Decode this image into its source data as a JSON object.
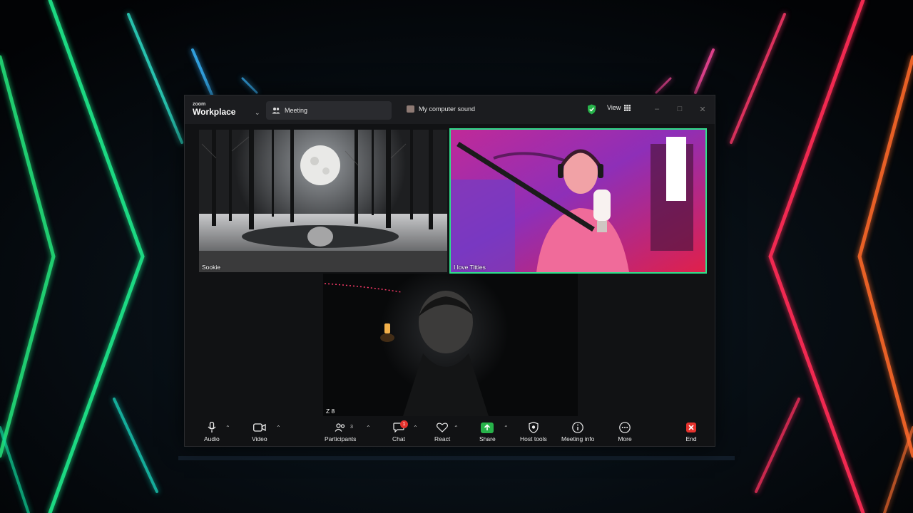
{
  "window": {
    "brand_small": "zoom",
    "brand_name": "Workplace",
    "tab_meeting_label": "Meeting",
    "tab_sound_label": "My computer sound",
    "view_label": "View"
  },
  "participants": [
    {
      "name": "Sookie"
    },
    {
      "name": "I love Titties"
    },
    {
      "name": "Z 8"
    }
  ],
  "toolbar": {
    "audio_label": "Audio",
    "video_label": "Video",
    "participants_label": "Participants",
    "participants_count": "3",
    "chat_label": "Chat",
    "chat_badge": "1",
    "react_label": "React",
    "share_label": "Share",
    "host_tools_label": "Host tools",
    "meeting_info_label": "Meeting info",
    "more_label": "More",
    "end_label": "End"
  },
  "colors": {
    "active_speaker_border": "#2fe08b",
    "share_green": "#27b34a",
    "end_red": "#e5322d"
  }
}
